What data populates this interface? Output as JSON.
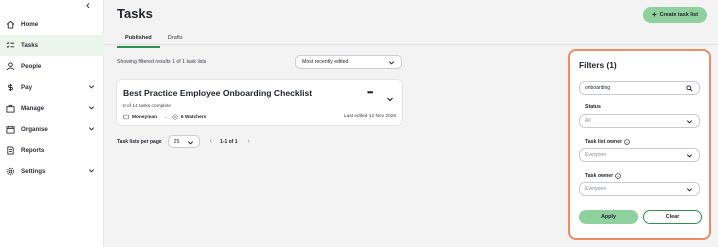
{
  "sidebar": {
    "collapse_glyph": "‹",
    "items": [
      {
        "label": "Home",
        "icon": "home-icon"
      },
      {
        "label": "Tasks",
        "icon": "tasks-icon",
        "active": true
      },
      {
        "label": "People",
        "icon": "person-icon"
      },
      {
        "label": "Pay",
        "icon": "dollar-icon",
        "expandable": true
      },
      {
        "label": "Manage",
        "icon": "briefcase-icon",
        "expandable": true
      },
      {
        "label": "Organise",
        "icon": "calendar-icon",
        "expandable": true
      },
      {
        "label": "Reports",
        "icon": "document-icon"
      },
      {
        "label": "Settings",
        "icon": "gear-icon",
        "expandable": true
      }
    ]
  },
  "header": {
    "title": "Tasks",
    "create_button": "Create task list",
    "create_button_glyph": "+"
  },
  "tabs": [
    {
      "label": "Published",
      "active": true
    },
    {
      "label": "Drafts"
    }
  ],
  "results": {
    "text": "Showing filtered results 1 of 1 task lists",
    "sort_value": "Most recently edited"
  },
  "card": {
    "title": "Best Practice Employee Onboarding Checklist",
    "more_glyph": "•••",
    "progress": "0 of 14 tasks complete",
    "owner": "Moneyman",
    "arrow": "→",
    "watchers": "6 Watchers",
    "edited": "Last edited 12 Nov 2026"
  },
  "pagination": {
    "label": "Task lists per page",
    "per_page": "25",
    "prev_glyph": "‹",
    "range": "1-1 of 1",
    "next_glyph": "›"
  },
  "filters": {
    "title": "Filters (1)",
    "search_value": "onboarding",
    "status_label": "Status",
    "status_value": "All",
    "owner_label": "Task list owner",
    "owner_value": "Everyone",
    "task_owner_label": "Task owner",
    "task_owner_value": "Everyone",
    "apply": "Apply",
    "clear": "Clear"
  },
  "colors": {
    "accent_green": "#8fd19e",
    "active_tab": "#2f8f4e",
    "filter_border": "#ef8a66"
  }
}
